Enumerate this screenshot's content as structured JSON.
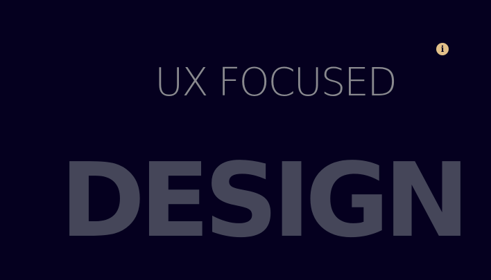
{
  "hero": {
    "subtitle": "UX FOCUSED",
    "headline": "DESIGN"
  },
  "info": {
    "icon": "info-icon",
    "glyph": "i"
  },
  "colors": {
    "background": "#05001f",
    "subtitle": "#8a8a8f",
    "headline": "#454659",
    "icon": "#e2c089"
  }
}
